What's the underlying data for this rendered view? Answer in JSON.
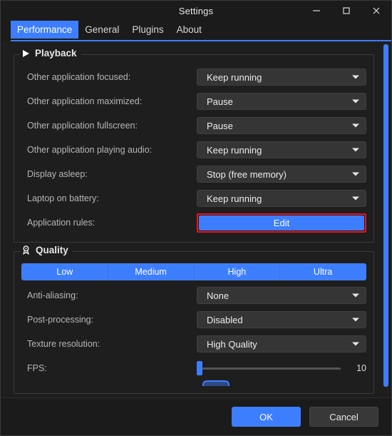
{
  "window": {
    "title": "Settings",
    "controls": {
      "minimize": "minimize-icon",
      "maximize": "maximize-icon",
      "close": "close-icon"
    }
  },
  "tabs": [
    {
      "label": "Performance",
      "active": true
    },
    {
      "label": "General",
      "active": false
    },
    {
      "label": "Plugins",
      "active": false
    },
    {
      "label": "About",
      "active": false
    }
  ],
  "colors": {
    "accent": "#3d7eff",
    "highlight": "#f1111b",
    "window_bg": "#1e1e1e",
    "titlebar_bg": "#1b1b1b",
    "field_bg": "#353535",
    "label_text": "#b6b6b6"
  },
  "playback": {
    "title": "Playback",
    "icon": "play-triangle-icon",
    "rows": [
      {
        "label": "Other application focused:",
        "value": "Keep running",
        "type": "combo"
      },
      {
        "label": "Other application maximized:",
        "value": "Pause",
        "type": "combo"
      },
      {
        "label": "Other application fullscreen:",
        "value": "Pause",
        "type": "combo"
      },
      {
        "label": "Other application playing audio:",
        "value": "Keep running",
        "type": "combo"
      },
      {
        "label": "Display asleep:",
        "value": "Stop (free memory)",
        "type": "combo"
      },
      {
        "label": "Laptop on battery:",
        "value": "Keep running",
        "type": "combo"
      },
      {
        "label": "Application rules:",
        "value": "Edit",
        "type": "button-highlighted"
      }
    ]
  },
  "quality": {
    "title": "Quality",
    "icon": "award-medal-icon",
    "presets": [
      "Low",
      "Medium",
      "High",
      "Ultra"
    ],
    "rows": [
      {
        "label": "Anti-aliasing:",
        "value": "None",
        "type": "combo"
      },
      {
        "label": "Post-processing:",
        "value": "Disabled",
        "type": "combo"
      },
      {
        "label": "Texture resolution:",
        "value": "High Quality",
        "type": "combo"
      }
    ],
    "fps": {
      "label": "FPS:",
      "value": "10",
      "handle_percent": 0
    }
  },
  "footer": {
    "ok": "OK",
    "cancel": "Cancel"
  }
}
